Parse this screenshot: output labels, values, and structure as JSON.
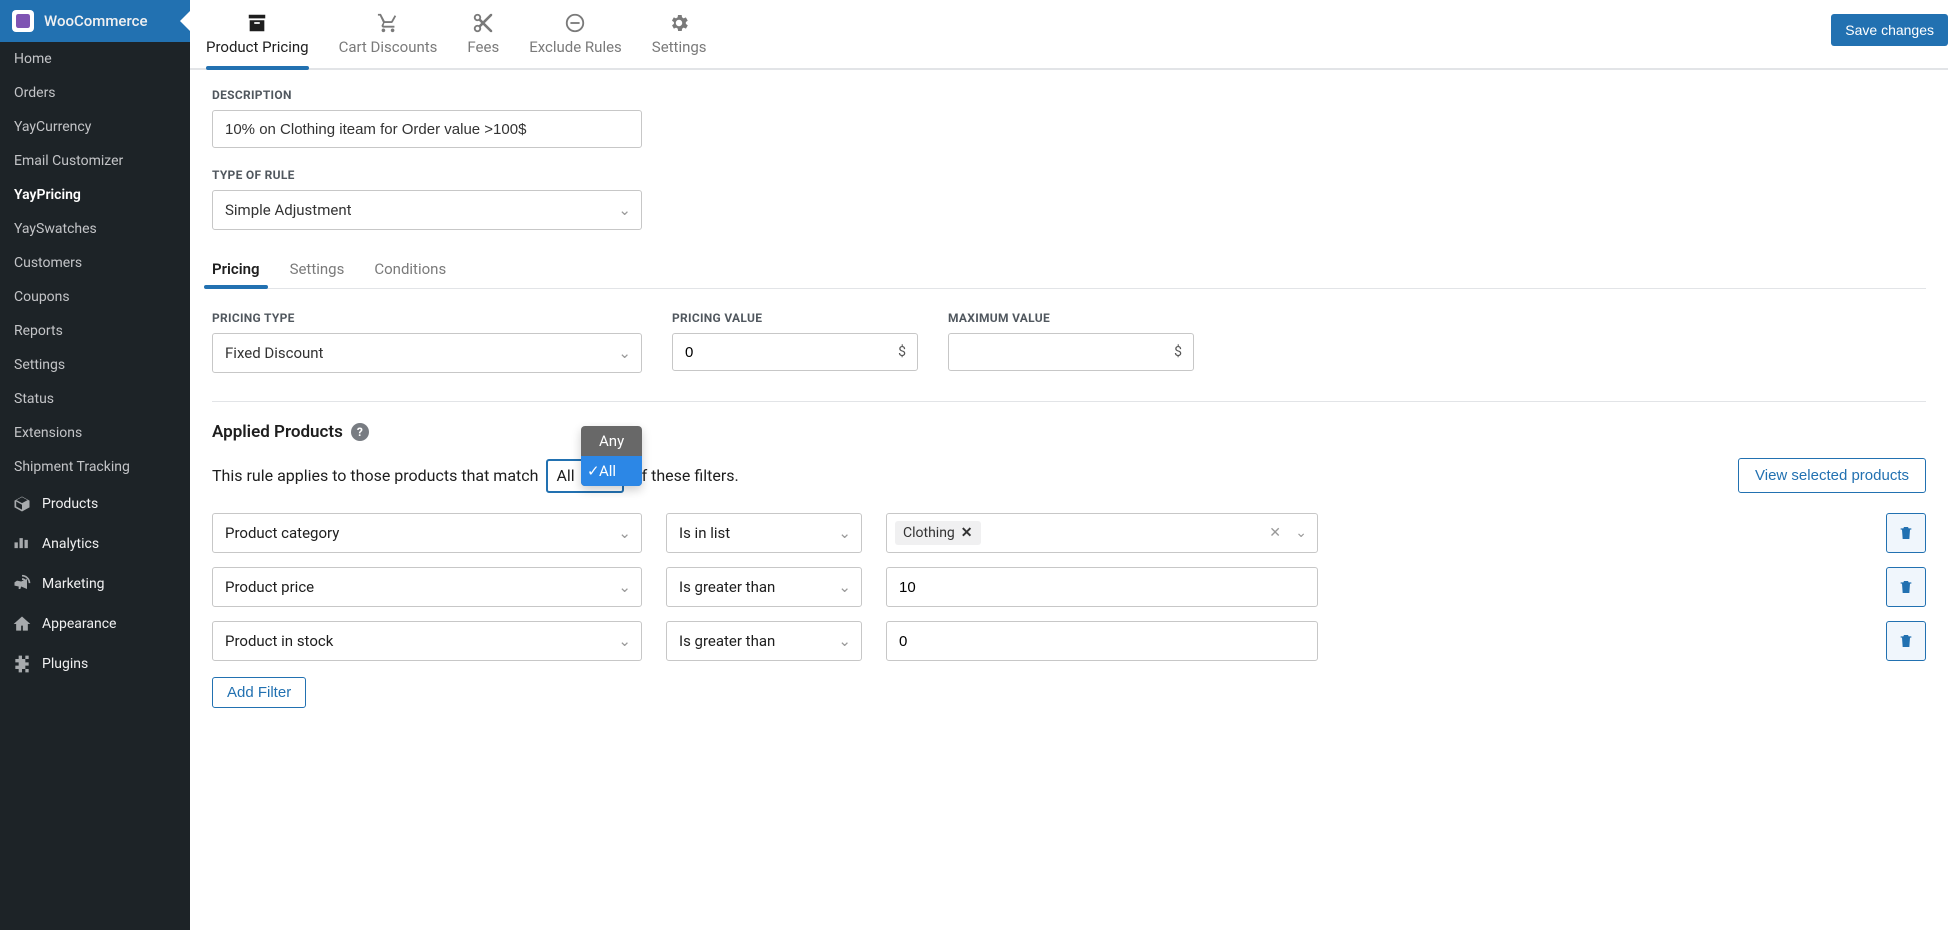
{
  "sidebar": {
    "header": "WooCommerce",
    "items": [
      {
        "label": "Home"
      },
      {
        "label": "Orders"
      },
      {
        "label": "YayCurrency"
      },
      {
        "label": "Email Customizer"
      },
      {
        "label": "YayPricing",
        "active": true
      },
      {
        "label": "YaySwatches"
      },
      {
        "label": "Customers"
      },
      {
        "label": "Coupons"
      },
      {
        "label": "Reports"
      },
      {
        "label": "Settings"
      },
      {
        "label": "Status"
      },
      {
        "label": "Extensions"
      },
      {
        "label": "Shipment Tracking"
      }
    ],
    "sections": [
      {
        "label": "Products"
      },
      {
        "label": "Analytics"
      },
      {
        "label": "Marketing"
      },
      {
        "label": "Appearance"
      },
      {
        "label": "Plugins"
      }
    ]
  },
  "toptabs": [
    {
      "label": "Product Pricing",
      "active": true
    },
    {
      "label": "Cart Discounts"
    },
    {
      "label": "Fees"
    },
    {
      "label": "Exclude Rules"
    },
    {
      "label": "Settings"
    }
  ],
  "save_label": "Save changes",
  "description_label": "DESCRIPTION",
  "description_value": "10% on Clothing iteam for Order value >100$",
  "type_of_rule_label": "TYPE OF RULE",
  "type_of_rule_value": "Simple Adjustment",
  "innertabs": [
    {
      "label": "Pricing",
      "active": true
    },
    {
      "label": "Settings"
    },
    {
      "label": "Conditions"
    }
  ],
  "pricing_type_label": "PRICING TYPE",
  "pricing_type_value": "Fixed Discount",
  "pricing_value_label": "PRICING VALUE",
  "pricing_value_value": "0",
  "maximum_value_label": "MAXIMUM VALUE",
  "maximum_value_value": "",
  "currency_symbol": "$",
  "applied_products_label": "Applied Products",
  "applies_text_pre": "This rule applies to those products that match",
  "applies_text_post": "of these filters.",
  "match_selected": "All",
  "match_options": [
    {
      "label": "Any",
      "active": false
    },
    {
      "label": "All",
      "active": true
    }
  ],
  "view_selected_label": "View selected products",
  "filter_rows": [
    {
      "left": "Product category",
      "op": "Is in list",
      "tag": "Clothing",
      "value": ""
    },
    {
      "left": "Product price",
      "op": "Is greater than",
      "tag": "",
      "value": "10"
    },
    {
      "left": "Product in stock",
      "op": "Is greater than",
      "tag": "",
      "value": "0"
    }
  ],
  "add_filter_label": "Add Filter"
}
